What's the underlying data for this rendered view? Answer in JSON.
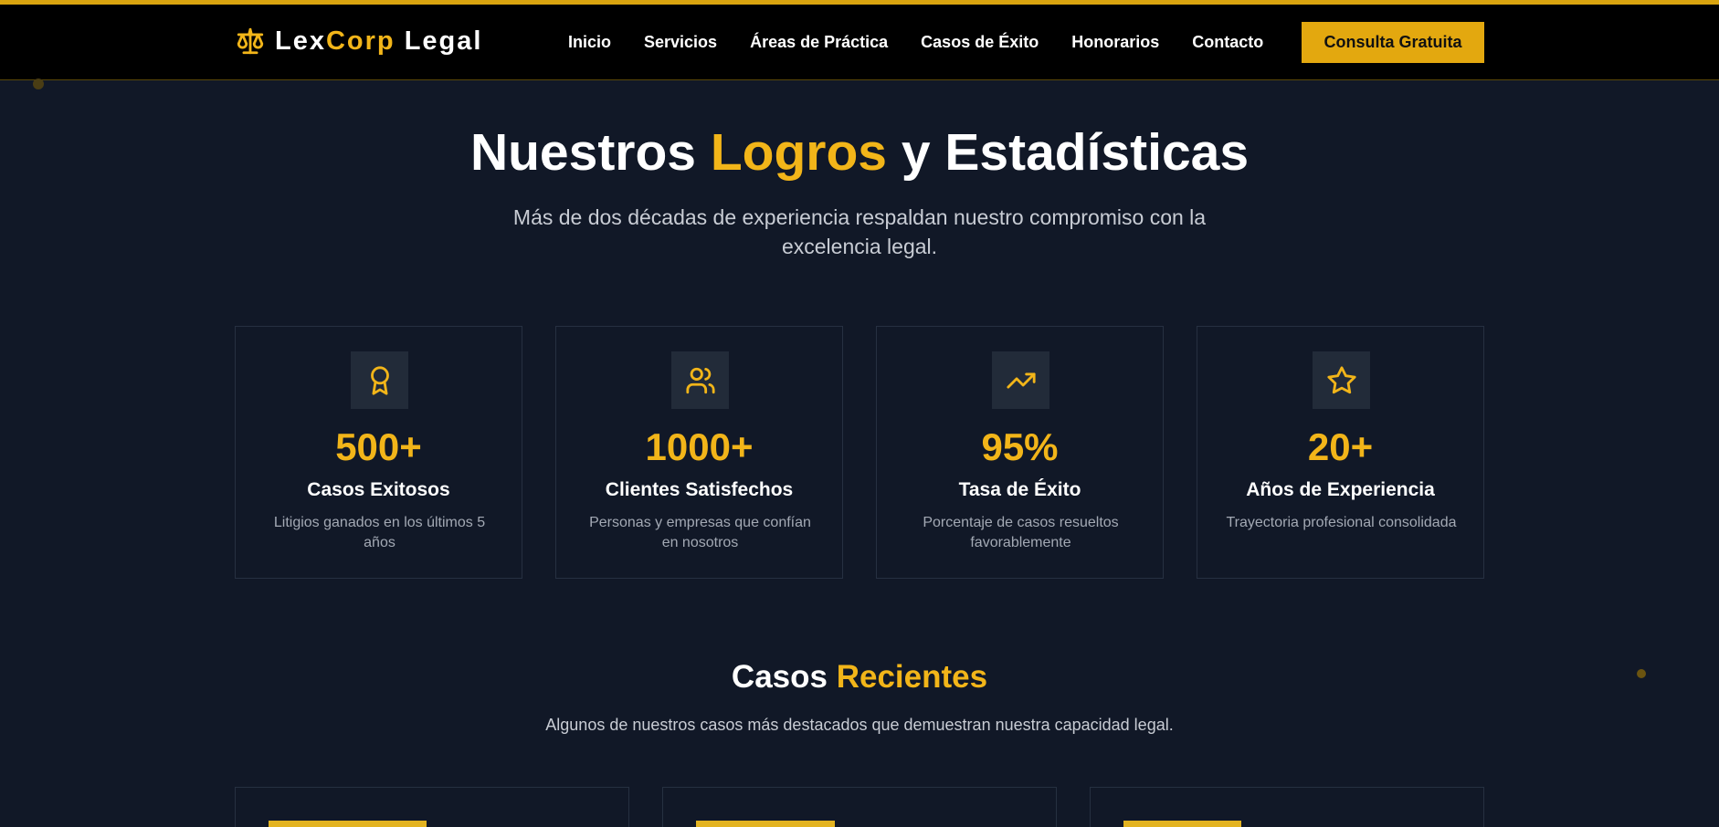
{
  "brand": {
    "name_part1": "Lex",
    "name_part2": "Corp",
    "name_part3": "Legal",
    "icon": "scales-icon"
  },
  "nav": {
    "items": [
      {
        "label": "Inicio"
      },
      {
        "label": "Servicios"
      },
      {
        "label": "Áreas de Práctica"
      },
      {
        "label": "Casos de Éxito"
      },
      {
        "label": "Honorarios"
      },
      {
        "label": "Contacto"
      }
    ],
    "cta_label": "Consulta Gratuita"
  },
  "stats_section": {
    "title_part1": "Nuestros ",
    "title_accent": "Logros",
    "title_part2": " y Estadísticas",
    "subtitle": "Más de dos décadas de experiencia respaldan nuestro compromiso con la excelencia legal.",
    "cards": [
      {
        "icon": "award-icon",
        "value": "500+",
        "label": "Casos Exitosos",
        "description": "Litigios ganados en los últimos 5 años"
      },
      {
        "icon": "users-icon",
        "value": "1000+",
        "label": "Clientes Satisfechos",
        "description": "Personas y empresas que confían en nosotros"
      },
      {
        "icon": "trending-up-icon",
        "value": "95%",
        "label": "Tasa de Éxito",
        "description": "Porcentaje de casos resueltos favorablemente"
      },
      {
        "icon": "star-icon",
        "value": "20+",
        "label": "Años de Experiencia",
        "description": "Trayectoria profesional consolidada"
      }
    ]
  },
  "cases_section": {
    "title_part1": "Casos ",
    "title_accent": "Recientes",
    "subtitle": "Algunos de nuestros casos más destacados que demuestran nuestra capacidad legal."
  },
  "colors": {
    "accent": "#f2b519",
    "background": "#111827",
    "header": "#000000",
    "button": "#e3a80f"
  }
}
